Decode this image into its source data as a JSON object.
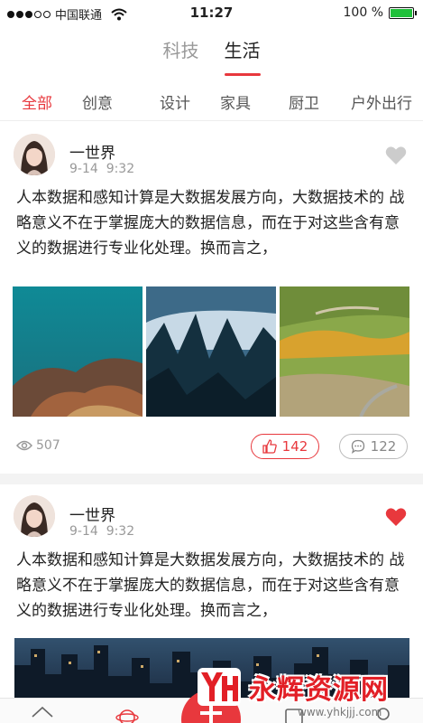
{
  "status_bar": {
    "carrier": "中国联通",
    "time": "11:27",
    "battery": "100 %",
    "battery_level": 1.0
  },
  "top_tabs": [
    {
      "label": "科技",
      "active": false
    },
    {
      "label": "生活",
      "active": true
    }
  ],
  "categories": [
    {
      "label": "全部",
      "active": true
    },
    {
      "label": "创意",
      "active": false
    },
    {
      "label": "设计",
      "active": false
    },
    {
      "label": "家具",
      "active": false
    },
    {
      "label": "厨卫",
      "active": false
    },
    {
      "label": "户外出行",
      "active": false
    }
  ],
  "posts": [
    {
      "author": "一世界",
      "date": "9-14",
      "time": "9:32",
      "liked": false,
      "text": "人本数据和感知计算是大数据发展方向，大数据技术的 战略意义不在于掌握庞大的数据信息，而在于对这些含有意义的数据进行专业化处理。换而言之，",
      "views": "507",
      "likes": "142",
      "comments": "122",
      "images": [
        "lake-rocks-photo",
        "misty-forest-photo",
        "autumn-meadow-photo"
      ]
    },
    {
      "author": "一世界",
      "date": "9-14",
      "time": "9:32",
      "liked": true,
      "text": "人本数据和感知计算是大数据发展方向，大数据技术的 战略意义不在于掌握庞大的数据信息，而在于对这些含有意义的数据进行专业化处理。换而言之，",
      "images": [
        "city-skyline-photo"
      ]
    }
  ],
  "watermark": {
    "logo": "YH",
    "title": "永辉资源网",
    "url": "www.yhkjjj.com"
  },
  "colors": {
    "accent": "#e8383d",
    "muted": "#999999",
    "heart_inactive": "#cccccc"
  },
  "icons": [
    "signal-dots-icon",
    "wifi-icon",
    "battery-icon",
    "heart-icon",
    "eye-icon",
    "thumbs-up-icon",
    "comment-bubble-icon",
    "home-icon",
    "discover-icon",
    "add-icon",
    "message-icon",
    "profile-icon"
  ]
}
